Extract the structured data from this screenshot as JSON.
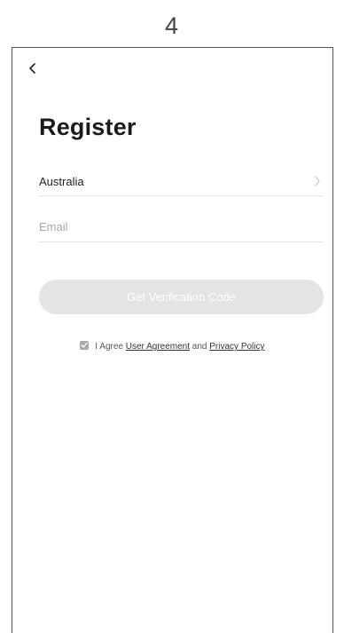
{
  "step": {
    "number": "4"
  },
  "header": {
    "back_icon": "chevron-left-icon"
  },
  "title": "Register",
  "country": {
    "label": "Australia",
    "icon": "chevron-right-icon"
  },
  "email": {
    "placeholder": "Email",
    "value": ""
  },
  "verify_button": {
    "label": "Get Verification Code",
    "bg_color": "#e4e4e4",
    "text_color": "#ffffff"
  },
  "agreement": {
    "checked": true,
    "prefix": "I Agree",
    "user_agreement_link": "User Agreement",
    "conjunction": "and",
    "privacy_policy_link": "Privacy Policy"
  }
}
